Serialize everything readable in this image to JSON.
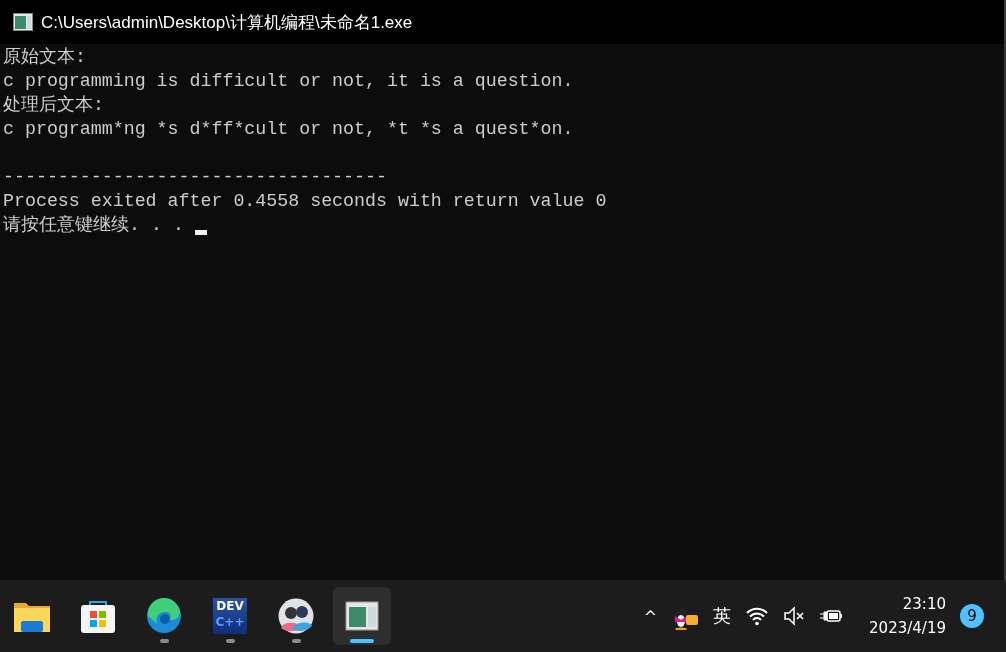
{
  "window": {
    "title": "C:\\Users\\admin\\Desktop\\计算机编程\\未命名1.exe"
  },
  "console": {
    "lines": [
      {
        "kind": "text",
        "text": "原始文本:"
      },
      {
        "kind": "text",
        "text": "c programming is difficult or not, it is a question."
      },
      {
        "kind": "text",
        "text": "处理后文本:"
      },
      {
        "kind": "text",
        "text": "c programm*ng *s d*ff*cult or not, *t *s a quest*on."
      },
      {
        "kind": "blank"
      },
      {
        "kind": "text",
        "text": "-----------------------------------"
      },
      {
        "kind": "text",
        "text": "Process exited after 0.4558 seconds with return value 0"
      },
      {
        "kind": "text",
        "text": "请按任意键继续. . . "
      }
    ],
    "cursor": true
  },
  "taskbar": {
    "apps": [
      {
        "kind": "folder",
        "running": false,
        "selected": false
      },
      {
        "kind": "store",
        "running": false,
        "selected": false
      },
      {
        "kind": "browser",
        "running": true,
        "selected": false
      },
      {
        "kind": "ide",
        "running": true,
        "selected": false,
        "logo_lines": [
          "DEV",
          "C++"
        ]
      },
      {
        "kind": "people",
        "running": true,
        "selected": false
      },
      {
        "kind": "console",
        "running": true,
        "selected": true
      }
    ],
    "tray": {
      "chevron": "^",
      "ime": "英",
      "time": "23:10",
      "date": "2023/4/19",
      "notifications": "9"
    }
  }
}
